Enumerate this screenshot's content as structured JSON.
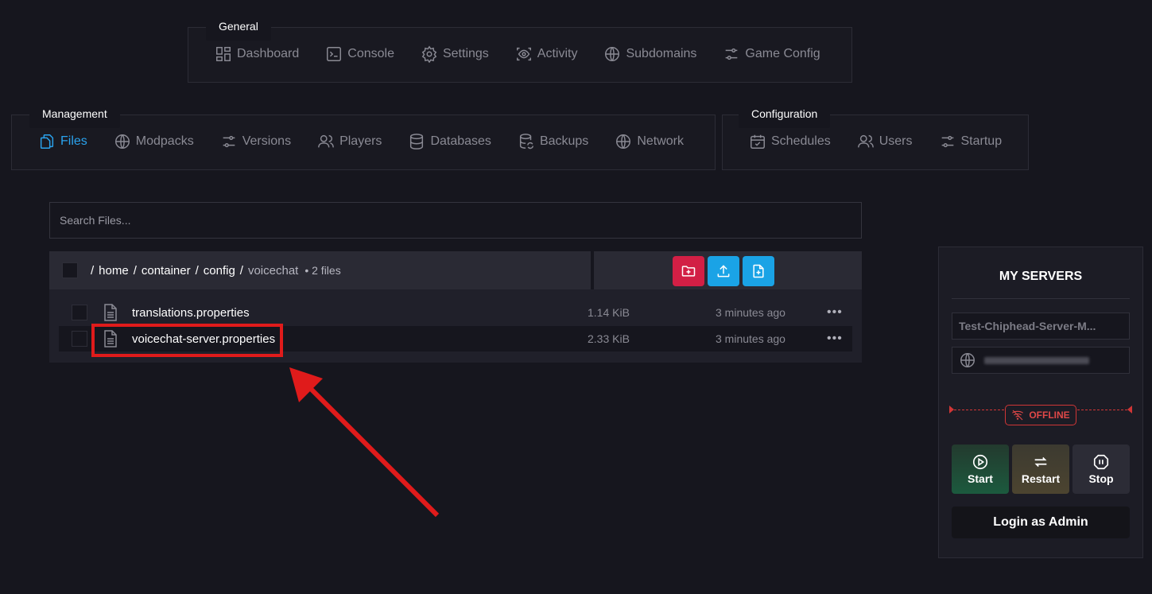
{
  "nav": {
    "general": {
      "title": "General",
      "items": [
        "Dashboard",
        "Console",
        "Settings",
        "Activity",
        "Subdomains",
        "Game Config"
      ]
    },
    "management": {
      "title": "Management",
      "items": [
        "Files",
        "Modpacks",
        "Versions",
        "Players",
        "Databases",
        "Backups",
        "Network"
      ],
      "active": "Files"
    },
    "configuration": {
      "title": "Configuration",
      "items": [
        "Schedules",
        "Users",
        "Startup"
      ]
    }
  },
  "search": {
    "placeholder": "Search Files..."
  },
  "breadcrumb": {
    "parts": [
      "/",
      "home",
      "/",
      "container",
      "/",
      "config",
      "/"
    ],
    "current": "voicechat",
    "count": "• 2 files"
  },
  "actions": {
    "new_folder_color": "#d21f45",
    "upload_color": "#1aa3e6",
    "new_file_color": "#1aa3e6"
  },
  "files": [
    {
      "name": "translations.properties",
      "size": "1.14 KiB",
      "modified": "3 minutes ago",
      "more": "•••"
    },
    {
      "name": "voicechat-server.properties",
      "size": "2.33 KiB",
      "modified": "3 minutes ago",
      "more": "•••"
    }
  ],
  "servers": {
    "title": "MY SERVERS",
    "server_name": "Test-Chiphead-Server-M...",
    "status": "OFFLINE",
    "buttons": {
      "start": "Start",
      "restart": "Restart",
      "stop": "Stop"
    },
    "admin": "Login as Admin"
  },
  "colors": {
    "accent": "#2aa3ee",
    "highlight": "#e01b1b",
    "offline": "#e04848"
  }
}
